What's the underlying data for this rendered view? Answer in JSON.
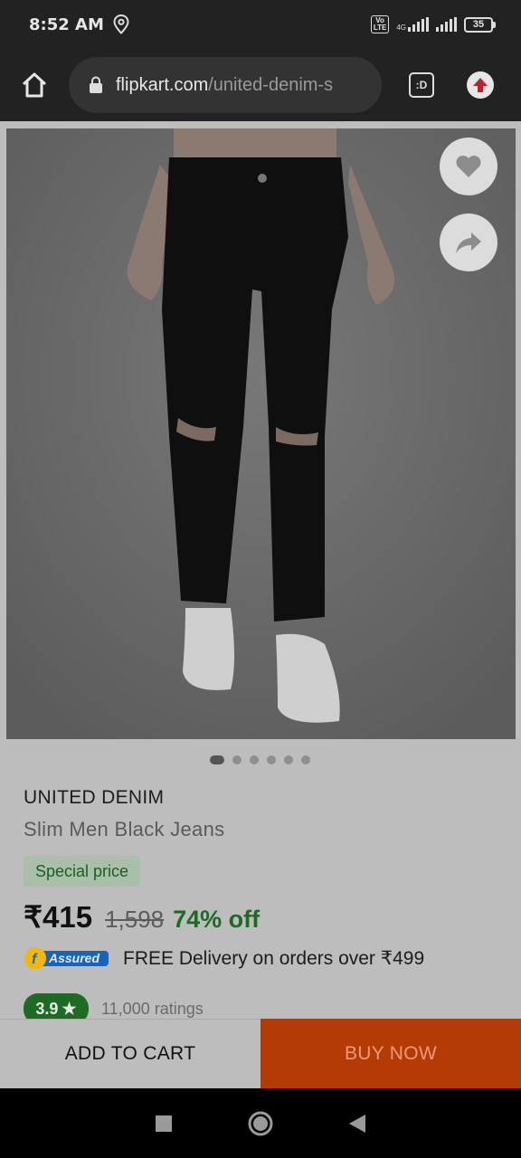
{
  "status_bar": {
    "time": "8:52 AM",
    "volte": "Vo\nLTE",
    "battery": "35",
    "network": "4G"
  },
  "browser": {
    "url_host": "flipkart.com",
    "url_path": "/united-denim-s",
    "tab_label": ":D"
  },
  "carousel": {
    "count": 6,
    "active_index": 0
  },
  "product": {
    "brand": "UNITED DENIM",
    "title": "Slim Men Black Jeans",
    "special_label": "Special price",
    "price": "₹415",
    "mrp": "1,598",
    "discount": "74% off",
    "assured_label": "Assured",
    "delivery_text": "FREE Delivery on orders over ₹499",
    "rating": "3.9",
    "rating_star": "★",
    "ratings_count": "11,000 ratings"
  },
  "actions": {
    "add_to_cart": "ADD TO CART",
    "buy_now": "BUY NOW"
  },
  "icons": [
    "location-icon",
    "home-icon",
    "lock-icon",
    "tab-switcher-icon",
    "update-icon",
    "heart-icon",
    "share-icon",
    "recents-icon",
    "home-circle-icon",
    "back-icon"
  ],
  "colors": {
    "buy_now": "#b53b06",
    "rating": "#1e6b23",
    "discount": "#1b6b22",
    "assured": "#1565c0"
  }
}
